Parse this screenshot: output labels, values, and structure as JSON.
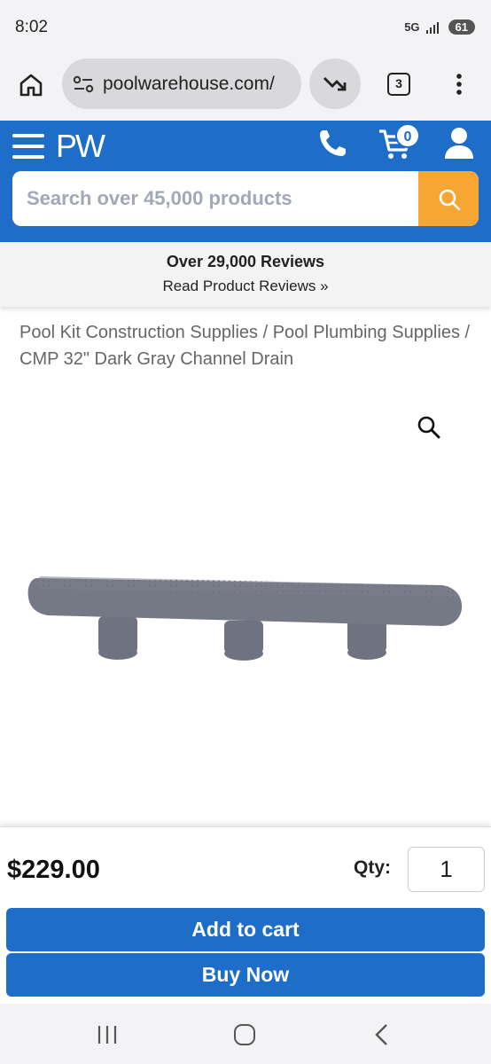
{
  "status_bar": {
    "time": "8:02",
    "network": "5G",
    "battery": "61"
  },
  "browser": {
    "url": "poolwarehouse.com/",
    "tab_count": "3"
  },
  "header": {
    "logo": "PW",
    "cart_count": "0",
    "search_placeholder": "Search over 45,000 products",
    "accent_color": "#1e6dc8",
    "search_button_color": "#f7a533"
  },
  "reviews": {
    "title": "Over 29,000 Reviews",
    "link": "Read Product Reviews »"
  },
  "breadcrumb": "Pool Kit Construction Supplies / Pool Plumbing Supplies / CMP 32\" Dark Gray Channel Drain",
  "product": {
    "price": "$229.00",
    "qty_label": "Qty:",
    "qty_value": "1",
    "add_to_cart": "Add to cart",
    "buy_now": "Buy Now"
  }
}
